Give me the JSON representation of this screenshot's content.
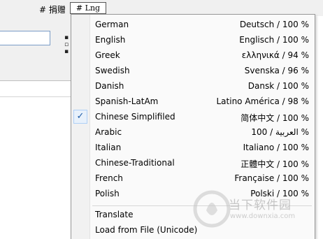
{
  "toolbar": {
    "donate_label": "# 捐赠",
    "lng_button_label": "# Lng"
  },
  "menu": {
    "items": [
      {
        "label": "German",
        "native": "Deutsch / 100 %",
        "checked": false
      },
      {
        "label": "English",
        "native": "Englisch / 100 %",
        "checked": false
      },
      {
        "label": "Greek",
        "native": "ελληνικά / 94 %",
        "checked": false
      },
      {
        "label": "Swedish",
        "native": "Svenska / 96 %",
        "checked": false
      },
      {
        "label": "Danish",
        "native": "Dansk / 100 %",
        "checked": false
      },
      {
        "label": "Spanish-LatAm",
        "native": "Latino América / 98 %",
        "checked": false
      },
      {
        "label": "Chinese Simplifiled",
        "native": "简体中文 / 100 %",
        "checked": true
      },
      {
        "label": "Arabic",
        "native": "100 / العربية %",
        "checked": false
      },
      {
        "label": "Italian",
        "native": "Italiano / 100 %",
        "checked": false
      },
      {
        "label": "Chinese-Traditional",
        "native": "正體中文 / 100 %",
        "checked": false
      },
      {
        "label": "French",
        "native": "Française / 100 %",
        "checked": false
      },
      {
        "label": "Polish",
        "native": "Polski / 100 %",
        "checked": false
      }
    ],
    "check_glyph": "✓",
    "actions": [
      {
        "label": "Translate"
      },
      {
        "label": "Load from File (Unicode)"
      }
    ]
  },
  "watermark": {
    "text": "当下软件园",
    "url": "www.downxia.com",
    "icon": "downxia-logo-icon"
  },
  "colors": {
    "menu_background": "#fafafa",
    "check_highlight": "#e8f1fb",
    "check_mark": "#1e5ca8",
    "window_background": "#f0f0f0"
  }
}
